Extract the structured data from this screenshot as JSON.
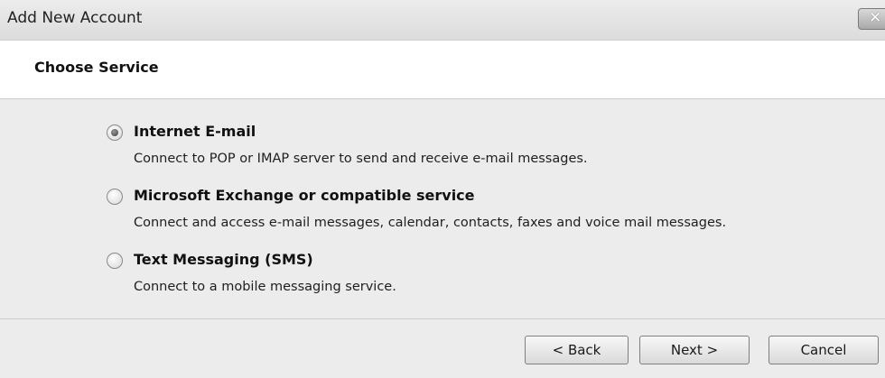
{
  "window": {
    "title": "Add New Account",
    "close_icon": "close-icon"
  },
  "header": {
    "title": "Choose Service"
  },
  "options": [
    {
      "label": "Internet E-mail",
      "description": "Connect to POP or IMAP server to send and receive e-mail messages.",
      "selected": true
    },
    {
      "label": "Microsoft Exchange or compatible service",
      "description": "Connect and access e-mail messages, calendar, contacts, faxes and voice mail messages.",
      "selected": false
    },
    {
      "label": "Text Messaging (SMS)",
      "description": "Connect to a mobile messaging service.",
      "selected": false
    }
  ],
  "buttons": {
    "back": "< Back",
    "next": "Next >",
    "cancel": "Cancel"
  }
}
